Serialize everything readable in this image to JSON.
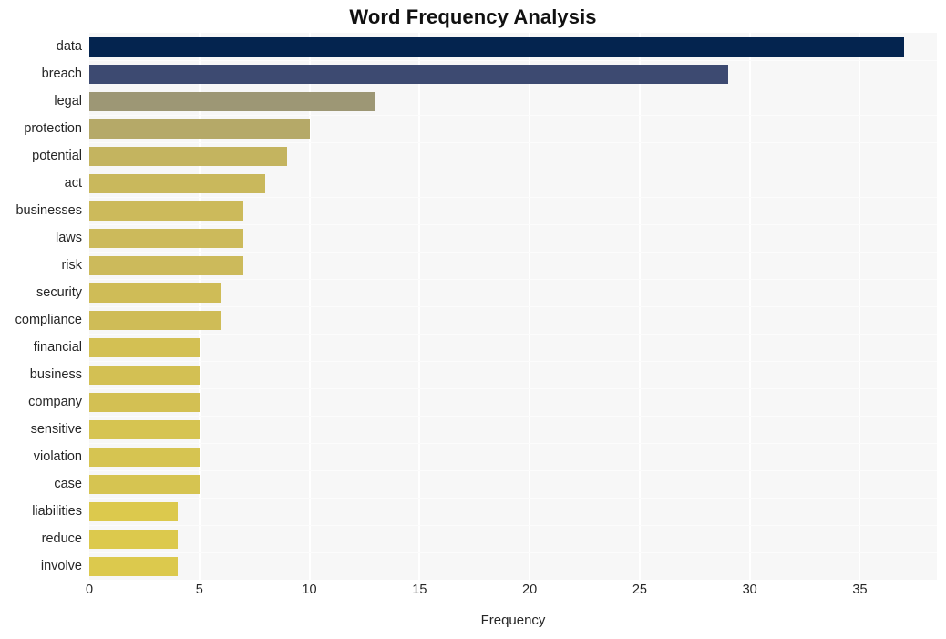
{
  "chart_data": {
    "type": "bar",
    "orientation": "horizontal",
    "title": "Word Frequency Analysis",
    "xlabel": "Frequency",
    "ylabel": "",
    "xlim": [
      0,
      38.5
    ],
    "xticks": [
      0,
      5,
      10,
      15,
      20,
      25,
      30,
      35
    ],
    "grid": "vertical-white-on-gray",
    "legend": "none",
    "categories": [
      "data",
      "breach",
      "legal",
      "protection",
      "potential",
      "act",
      "businesses",
      "laws",
      "risk",
      "security",
      "compliance",
      "financial",
      "business",
      "company",
      "sensitive",
      "violation",
      "case",
      "liabilities",
      "reduce",
      "involve"
    ],
    "values": [
      37,
      29,
      13,
      10,
      9,
      8,
      7,
      7,
      7,
      6,
      6,
      5,
      5,
      5,
      5,
      5,
      5,
      4,
      4,
      4
    ],
    "bar_colors": [
      "#04244f",
      "#3d4a71",
      "#9d9775",
      "#b5a968",
      "#c4b45f",
      "#c9b85c",
      "#ccba5b",
      "#ccba5b",
      "#ccba5b",
      "#cfbc57",
      "#cfbc57",
      "#d3c053",
      "#d3c053",
      "#d3c053",
      "#d6c451",
      "#d6c451",
      "#d6c451",
      "#dcc94d",
      "#dcc94d",
      "#dcc94d"
    ],
    "plot_background": "#f7f7f7",
    "figure_background": "#ffffff",
    "gridline_color": "#ffffff",
    "text_color": "#262626"
  }
}
